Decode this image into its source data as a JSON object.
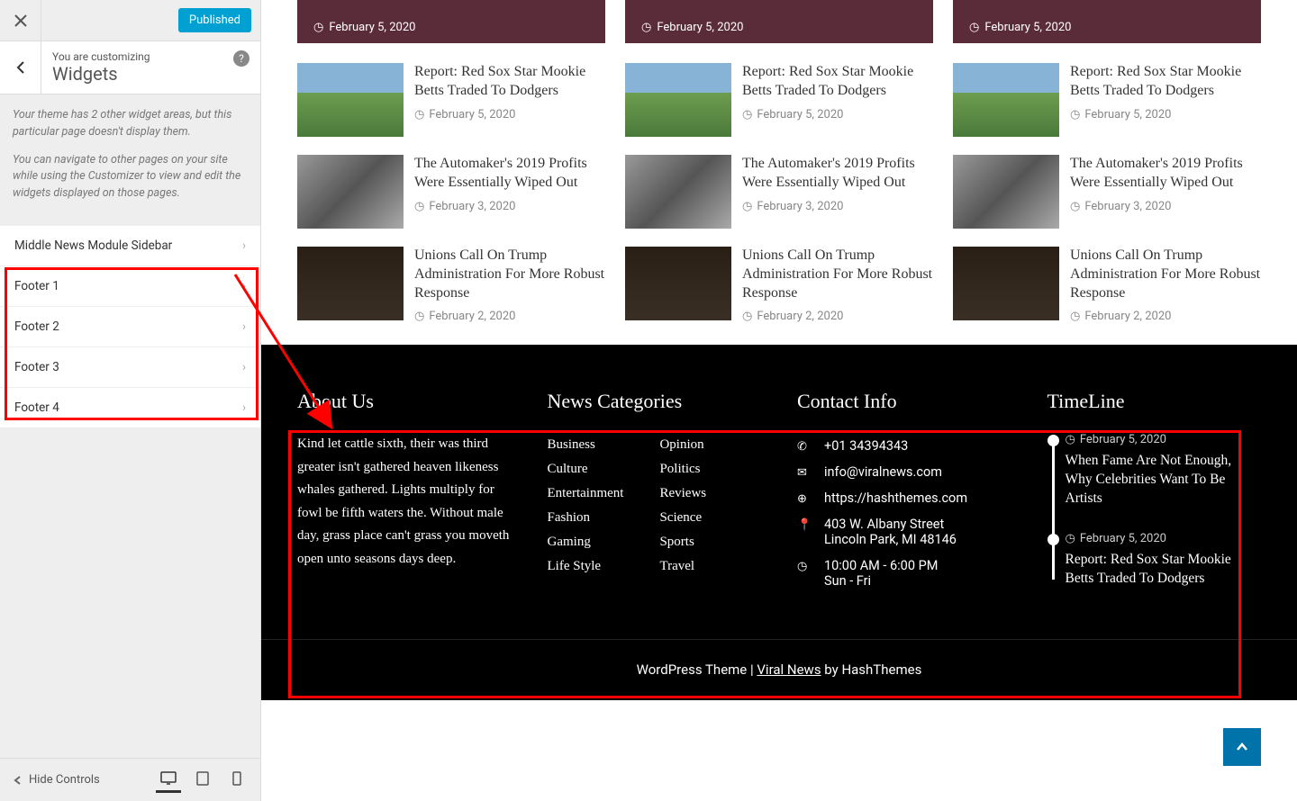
{
  "sidebar": {
    "publish_label": "Published",
    "customizing_label": "You are customizing",
    "section_title": "Widgets",
    "description_1": "Your theme has 2 other widget areas, but this particular page doesn't display them.",
    "description_2": "You can navigate to other pages on your site while using the Customizer to view and edit the widgets displayed on those pages.",
    "widget_areas": [
      "Middle News Module Sidebar",
      "Footer 1",
      "Footer 2",
      "Footer 3",
      "Footer 4"
    ],
    "hide_controls_label": "Hide Controls"
  },
  "preview": {
    "hero_date": "February 5, 2020",
    "articles": [
      {
        "title": "Report: Red Sox Star Mookie Betts Traded To Dodgers",
        "date": "February 5, 2020",
        "thumb": "stadium"
      },
      {
        "title": "The Automaker's 2019 Profits Were Essentially Wiped Out",
        "date": "February 3, 2020",
        "thumb": "engine"
      },
      {
        "title": "Unions Call On Trump Administration For More Robust Response",
        "date": "February 2, 2020",
        "thumb": "people"
      }
    ],
    "footer": {
      "about_title": "About Us",
      "about_text": "Kind let cattle sixth, their was third greater isn't gathered heaven likeness whales gathered. Lights multiply for fowl be fifth waters the. Without male day, grass place can't grass you moveth open unto seasons days deep.",
      "categories_title": "News Categories",
      "categories_left": [
        "Business",
        "Culture",
        "Entertainment",
        "Fashion",
        "Gaming",
        "Life Style"
      ],
      "categories_right": [
        "Opinion",
        "Politics",
        "Reviews",
        "Science",
        "Sports",
        "Travel"
      ],
      "contact_title": "Contact Info",
      "contact_phone": "+01 34394343",
      "contact_email": "info@viralnews.com",
      "contact_url": "https://hashthemes.com",
      "contact_addr_1": "403 W. Albany Street",
      "contact_addr_2": "Lincoln Park, MI 48146",
      "contact_hours_1": "10:00 AM - 6:00 PM",
      "contact_hours_2": "Sun - Fri",
      "timeline_title": "TimeLine",
      "timeline": [
        {
          "date": "February 5, 2020",
          "title": "When Fame Are Not Enough, Why Celebrities Want To Be Artists"
        },
        {
          "date": "February 5, 2020",
          "title": "Report: Red Sox Star Mookie Betts Traded To Dodgers"
        }
      ],
      "credit_prefix": "WordPress Theme | ",
      "credit_link": "Viral News",
      "credit_suffix": " by HashThemes"
    }
  }
}
